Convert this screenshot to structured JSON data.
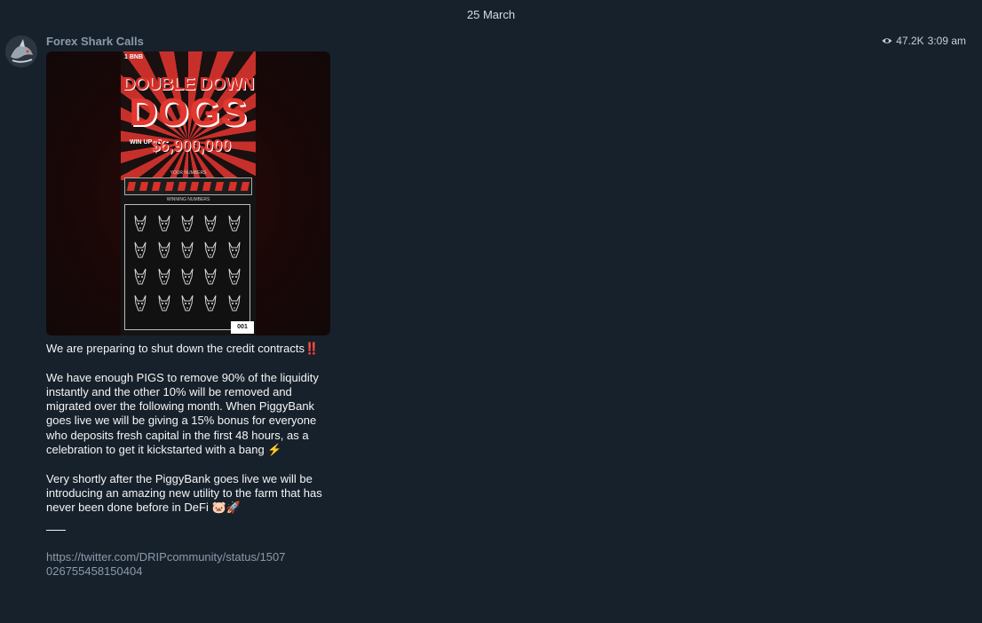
{
  "date_separator": "25 March",
  "channel": {
    "name": "Forex Shark Calls",
    "views": "47.2K",
    "time": "3:09 am"
  },
  "media": {
    "ticket_price": "1 BNB",
    "title_line1": "DOUBLE DOWN",
    "title_line2": "DOGS",
    "win_label": "WIN UP TO",
    "prize_amount": "$6,900,000",
    "your_numbers_label": "YOUR NUMBERS",
    "winning_numbers_label": "WINNING NUMBERS",
    "serial": "001"
  },
  "message": {
    "para1": "We are preparing to shut down the credit contracts‼️",
    "para2": "We have enough PIGS to remove 90% of the liquidity instantly and the other 10% will be removed and migrated over the following month.  When PiggyBank goes live we will be giving a 15% bonus for everyone who deposits fresh capital in the first 48 hours, as a celebration to get it kickstarted with a bang ⚡",
    "para3": "Very shortly after the PiggyBank goes live we will be introducing an amazing new utility to the farm that has never been done before in DeFi 🐷🚀",
    "link": "https://twitter.com/DRIPcommunity/status/1507026755458150404"
  },
  "colors": {
    "background": "#17212b",
    "channel_name": "#8a9aab",
    "link": "#8a9aab",
    "accent_red": "#e2382f"
  }
}
